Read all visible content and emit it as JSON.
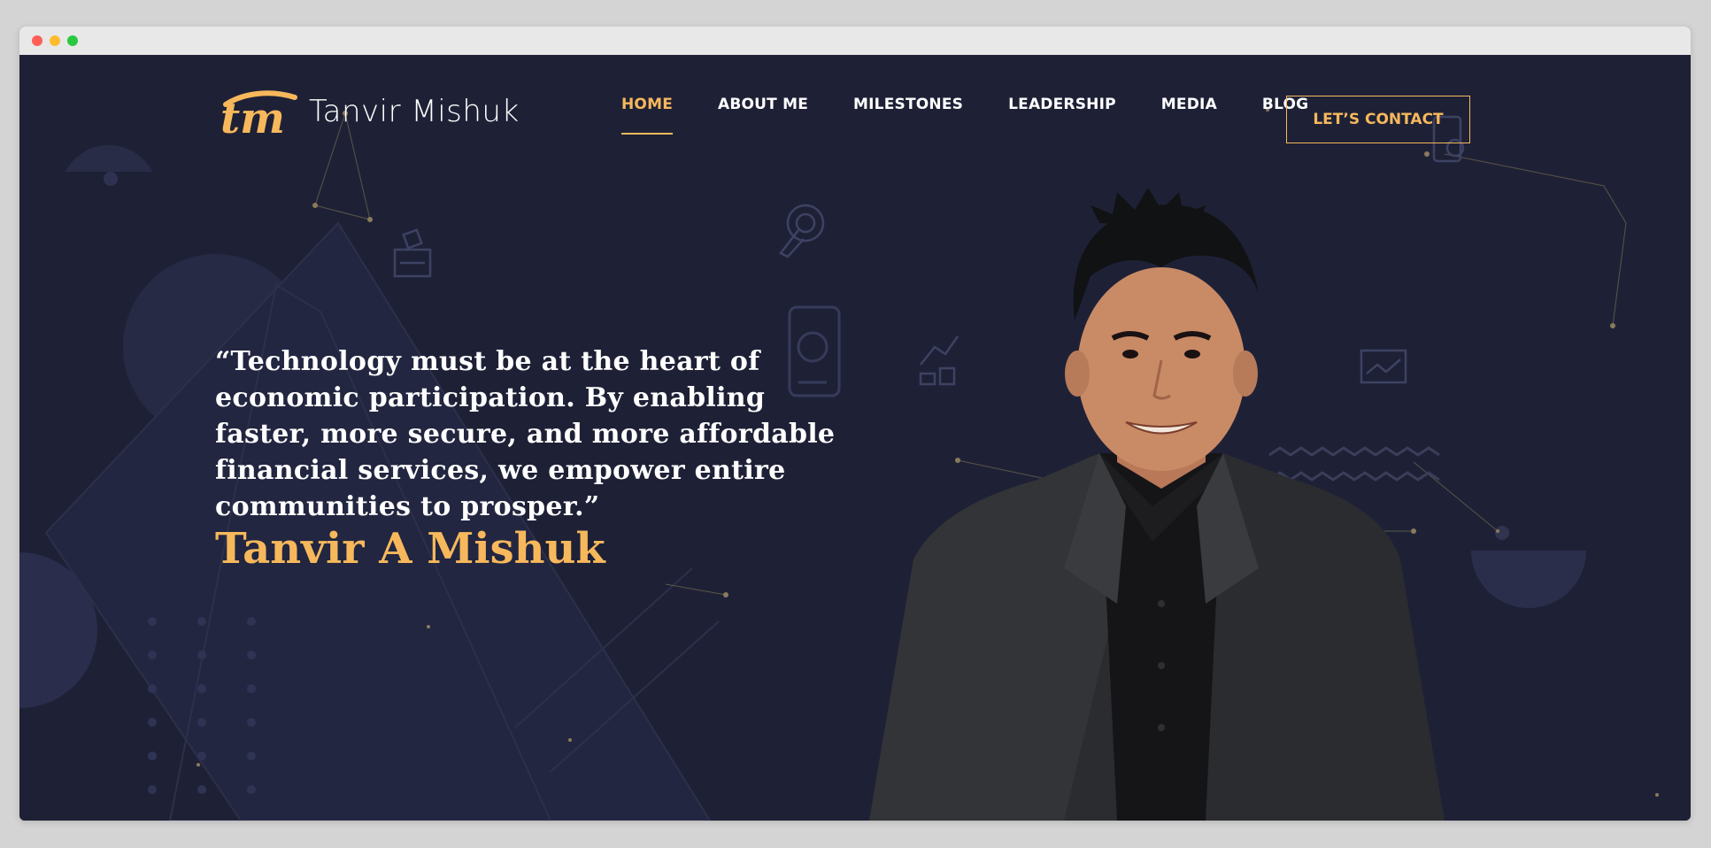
{
  "logo": {
    "mark": "tm",
    "name": "Tanvir  Mishuk"
  },
  "nav": {
    "items": [
      {
        "label": "HOME",
        "active": true
      },
      {
        "label": "ABOUT ME",
        "active": false
      },
      {
        "label": "MILESTONES",
        "active": false
      },
      {
        "label": "LEADERSHIP",
        "active": false
      },
      {
        "label": "MEDIA",
        "active": false
      },
      {
        "label": "BLOG",
        "active": false
      }
    ],
    "contact_label": "LET’S CONTACT"
  },
  "hero": {
    "quote": "“Technology must be at the heart of economic participation. By enabling faster, more secure, and more affordable financial services, we empower entire communities to prosper.”",
    "author": "Tanvir A Mishuk"
  },
  "colors": {
    "background": "#1e2136",
    "accent": "#f7b85c",
    "text": "#ffffff"
  },
  "icons": [
    "logo-icon",
    "money-box-icon",
    "touch-icon",
    "phone-coin-icon",
    "growth-chart-icon",
    "dashboard-icon",
    "mobile-payment-icon"
  ]
}
